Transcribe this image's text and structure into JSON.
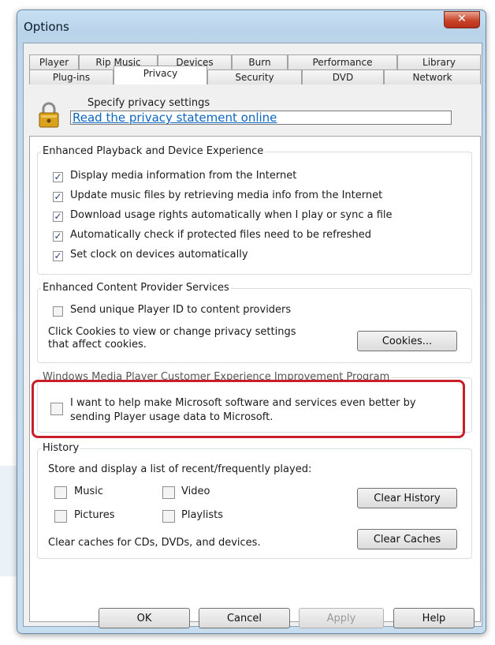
{
  "window": {
    "title": "Options",
    "close_glyph": "✕"
  },
  "tabs_row1": [
    "Player",
    "Rip Music",
    "Devices",
    "Burn",
    "Performance",
    "Library"
  ],
  "tabs_row2": [
    "Plug-ins",
    "Privacy",
    "Security",
    "DVD",
    "Network"
  ],
  "privacy": {
    "heading": "Specify privacy settings",
    "link": "Read the privacy statement online"
  },
  "playback_group": {
    "title": "Enhanced Playback and Device Experience",
    "items": [
      {
        "label": "Display media information from the Internet",
        "checked": true
      },
      {
        "label": "Update music files by retrieving media info from the Internet",
        "checked": true
      },
      {
        "label": "Download usage rights automatically when I play or sync a file",
        "checked": true
      },
      {
        "label": "Automatically check if protected files need to be refreshed",
        "checked": true
      },
      {
        "label": "Set clock on devices automatically",
        "checked": true
      }
    ]
  },
  "content_group": {
    "title": "Enhanced Content Provider Services",
    "send_id_label": "Send unique Player ID to content providers",
    "send_id_checked": false,
    "cookies_text_1": "Click Cookies to view or change privacy settings",
    "cookies_text_2": "that affect cookies.",
    "cookies_button": "Cookies..."
  },
  "ceip_group": {
    "title": "Windows Media Player Customer Experience Improvement Program",
    "line1": "I want to help make Microsoft software and services even better by",
    "line2": "sending Player usage data to Microsoft.",
    "checked": false
  },
  "history_group": {
    "title": "History",
    "intro": "Store and display a list of recent/frequently played:",
    "music": "Music",
    "video": "Video",
    "pictures": "Pictures",
    "playlists": "Playlists",
    "clear_history": "Clear History",
    "caches_text": "Clear caches for CDs, DVDs, and devices.",
    "clear_caches": "Clear Caches"
  },
  "buttons": {
    "ok": "OK",
    "cancel": "Cancel",
    "apply": "Apply",
    "help": "Help"
  },
  "colors": {
    "highlight": "#c8202a",
    "link": "#0c66c2"
  }
}
